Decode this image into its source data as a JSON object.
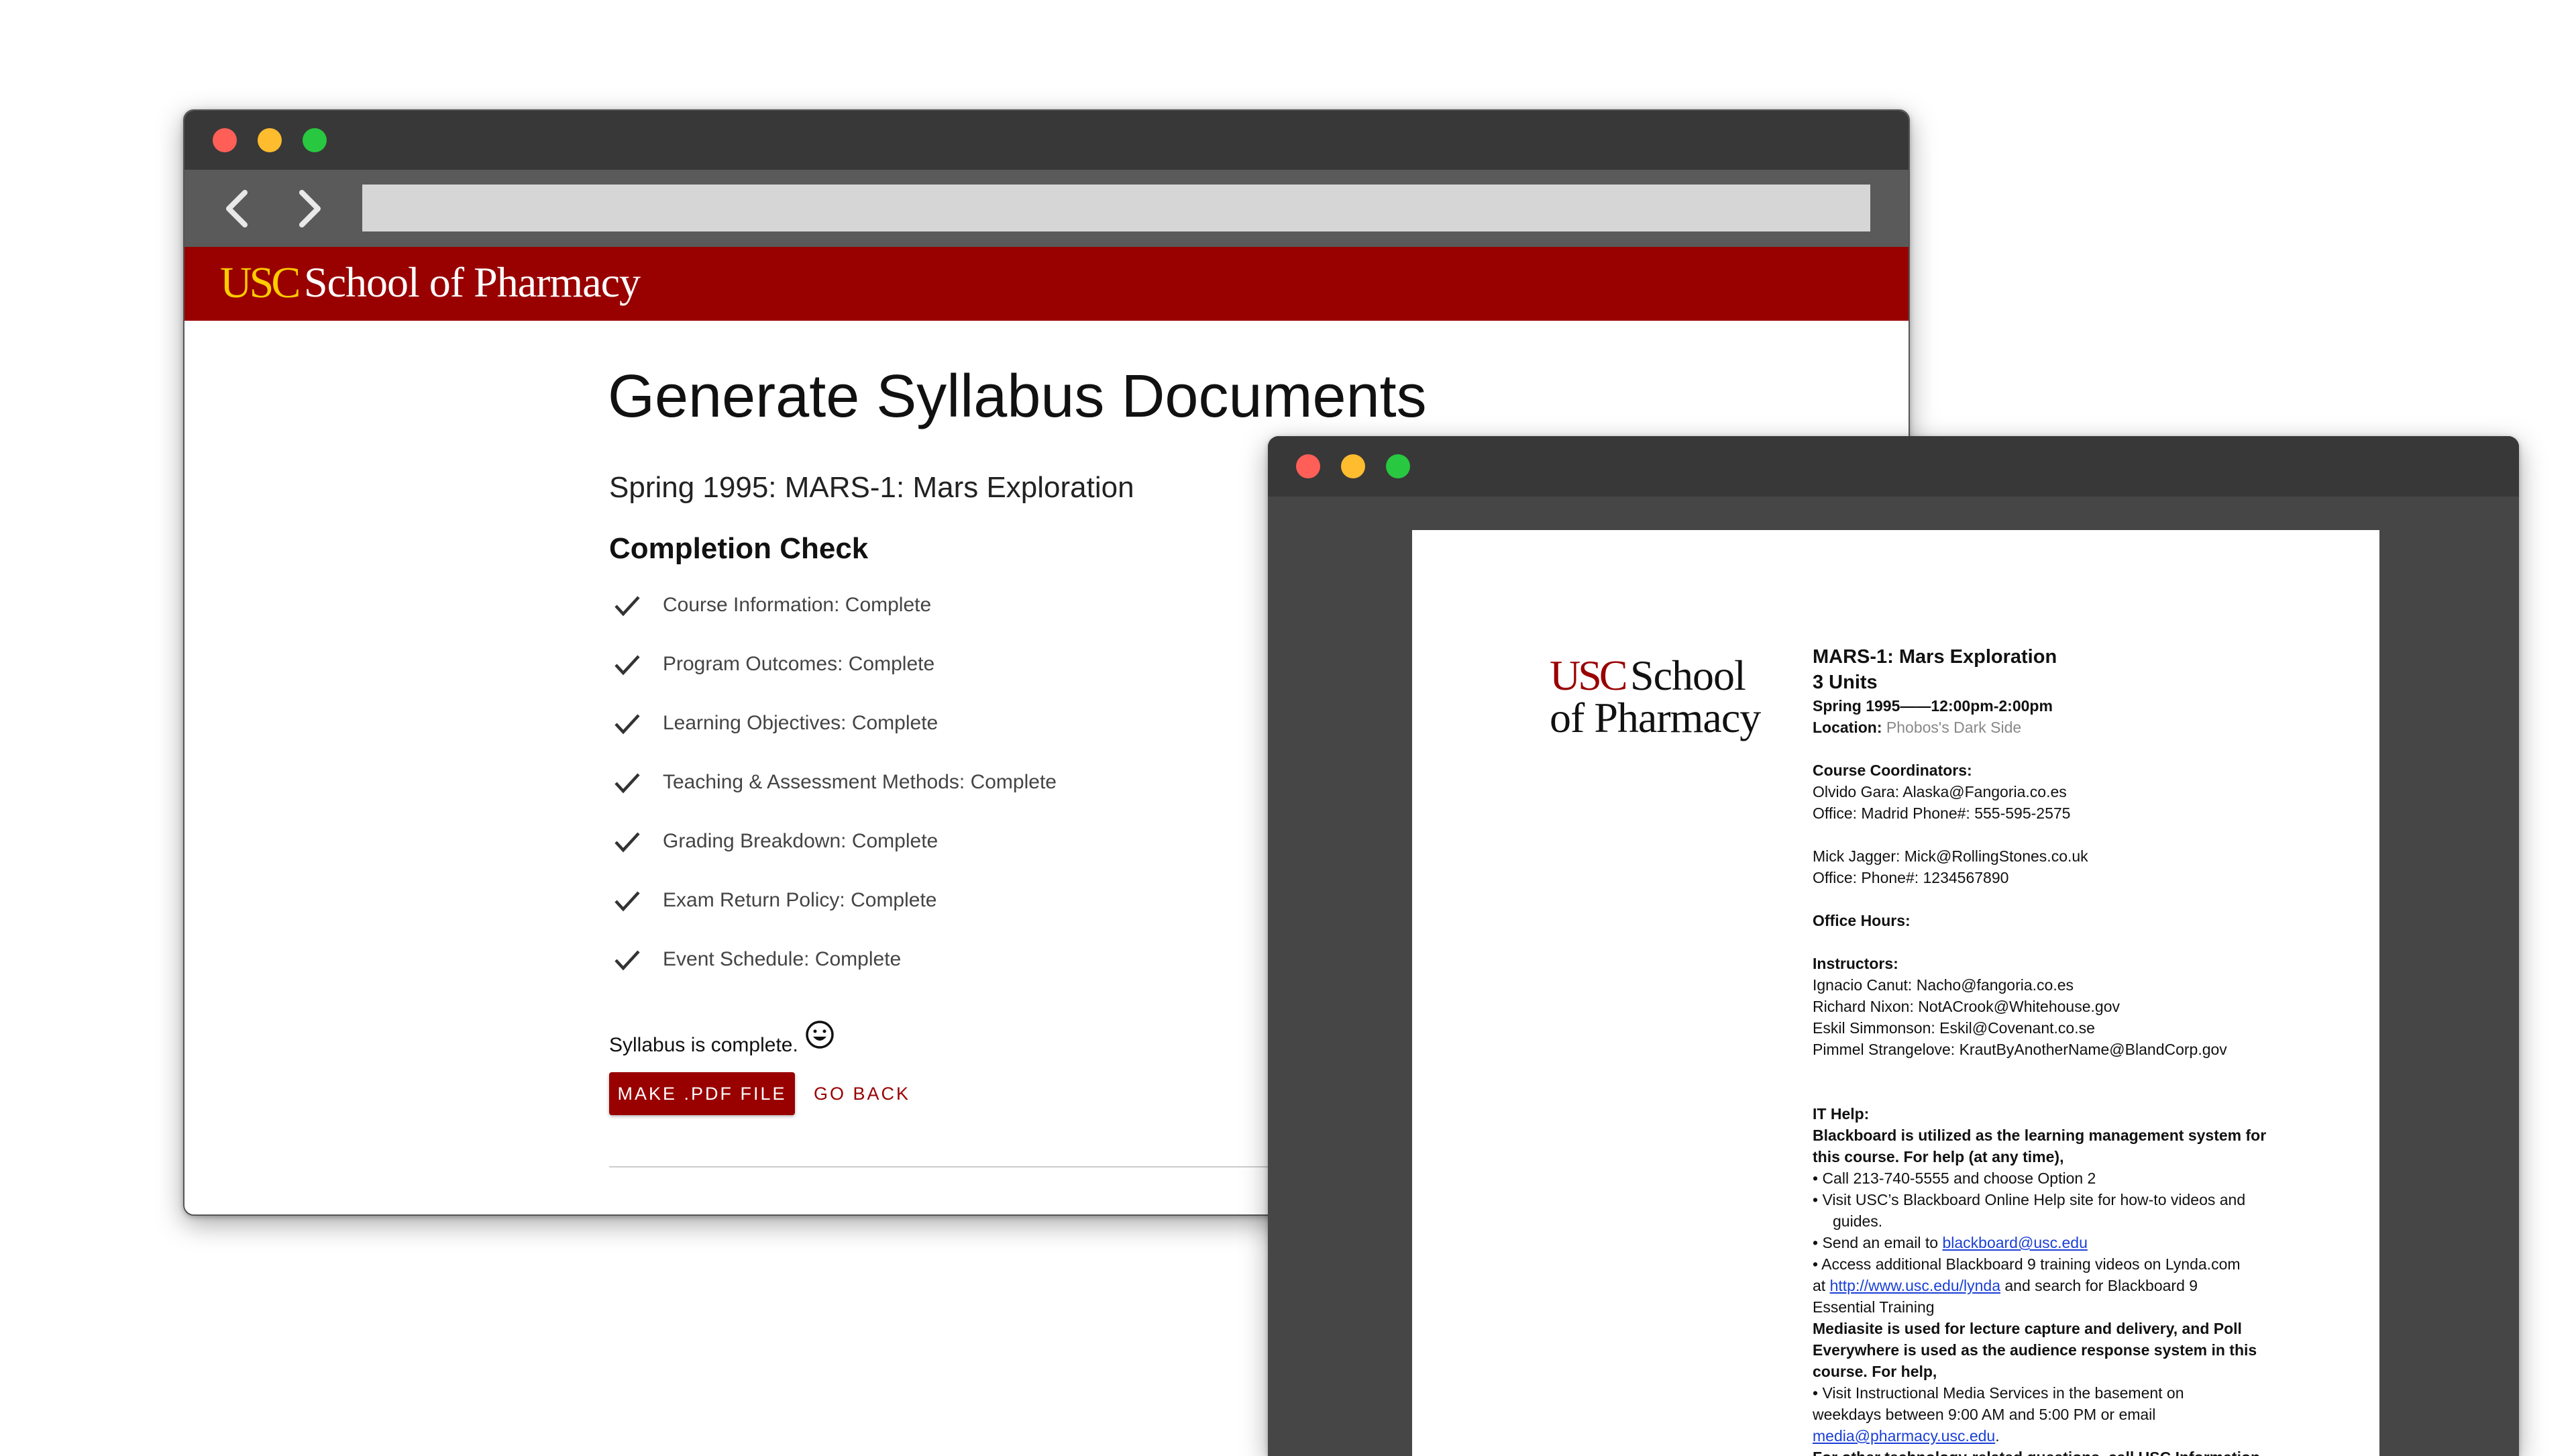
{
  "browser": {
    "window_dots": [
      "#ff5f57",
      "#febc2e",
      "#28c840"
    ],
    "back_icon": "chevron-left-icon",
    "forward_icon": "chevron-right-icon",
    "url": "",
    "header": {
      "logo_usc": "USC",
      "logo_school": "School of Pharmacy",
      "brand_red": "#990000",
      "brand_gold": "#ffcc00"
    }
  },
  "main": {
    "title": "Generate Syllabus Documents",
    "subtitle": "Spring 1995: MARS-1: Mars Exploration",
    "completion_heading": "Completion Check",
    "checks": [
      "Course Information: Complete",
      "Program Outcomes: Complete",
      "Learning Objectives: Complete",
      "Teaching & Assessment Methods: Complete",
      "Grading Breakdown: Complete",
      "Exam Return Policy: Complete",
      "Event Schedule: Complete"
    ],
    "complete_message": "Syllabus is complete.",
    "smiley_icon": "smiley-icon",
    "make_pdf_label": "MAKE .PDF FILE",
    "go_back_label": "GO BACK"
  },
  "pdf": {
    "logo_usc": "USC",
    "logo_school": "School",
    "logo_pharmacy": "of Pharmacy",
    "course_title": "MARS-1: Mars Exploration",
    "units": "3 Units",
    "term_time": "Spring 1995——12:00pm-2:00pm",
    "location_label": "Location:",
    "location_value": " Phobos's Dark Side",
    "coordinators_heading": "Course Coordinators:",
    "coord1_line1": "Olvido Gara:  Alaska@Fangoria.co.es",
    "coord1_line2": "Office: Madrid    Phone#: 555-595-2575",
    "coord2_line1": "Mick Jagger:  Mick@RollingStones.co.uk",
    "coord2_line2": "Office:      Phone#: 1234567890",
    "office_hours": "Office Hours:",
    "instructors_heading": "Instructors:",
    "instructors": [
      "Ignacio Canut: Nacho@fangoria.co.es",
      "Richard Nixon: NotACrook@Whitehouse.gov",
      "Eskil Simmonson: Eskil@Covenant.co.se",
      "Pimmel Strangelove: KrautByAnotherName@BlandCorp.gov"
    ],
    "it_heading": "IT Help:",
    "bb_line1": "Blackboard is utilized as the learning management system for",
    "bb_line2": "this course.  For help (at any time),",
    "bullet1": "•  Call 213-740-5555 and choose Option 2",
    "bullet2a": "•  Visit USC’s Blackboard Online Help site for how-to videos and",
    "bullet2b": "guides.",
    "bullet3_text": "•  Send an email to ",
    "bullet3_link": "blackboard@usc.edu",
    "bullet4a": "• Access additional Blackboard 9 training videos on Lynda.com",
    "bullet4b_pre": "at ",
    "bullet4b_link": "http://www.usc.edu/lynda",
    "bullet4b_post": " and search for Blackboard 9",
    "bullet4c": "Essential     Training",
    "media1": "Mediasite is used for lecture capture and delivery, and Poll",
    "media2": "Everywhere is used as the audience response system in this",
    "media3": "course.  For help,",
    "visit1": "• Visit Instructional Media Services in the basement on",
    "visit2": "weekdays between 9:00 AM and 5:00 PM or email",
    "visit3_link": "media@pharmacy.usc.edu",
    "visit3_post": ".",
    "other": "For other technology-related questions, call USC Information"
  }
}
